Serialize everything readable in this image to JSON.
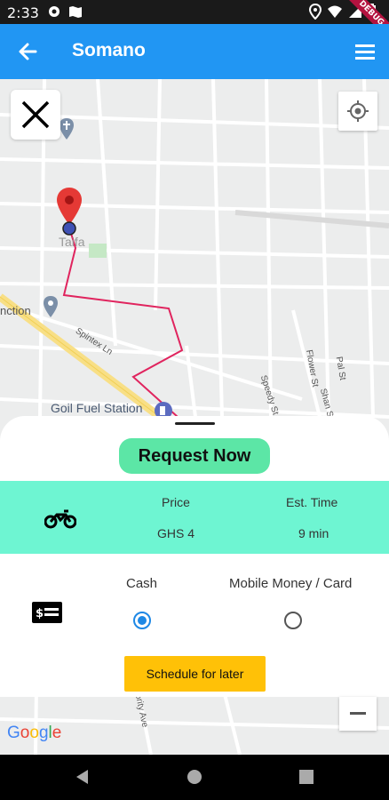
{
  "status_bar": {
    "time": "2:33"
  },
  "debug_banner": "DEBUG",
  "app_bar": {
    "title": "Somano"
  },
  "map": {
    "labels": {
      "taifa": "Taifa",
      "junction": "nction",
      "spintex": "Spintex Ln",
      "goil": "Goil Fuel Station",
      "flower": "Flower St",
      "road2": "Pal St",
      "road3": "Speedy St",
      "road4": "Shan St",
      "road5": "ority Ave"
    },
    "google": "Google"
  },
  "sheet": {
    "request_label": "Request Now",
    "ride_icon": "motorcycle-icon",
    "price_label": "Price",
    "price_value": "GHS 4",
    "time_label": "Est. Time",
    "time_value": "9 min",
    "payment_icon": "money-icon",
    "cash_label": "Cash",
    "mobile_label": "Mobile Money / Card",
    "selected_payment": "Cash",
    "schedule_label": "Schedule for later"
  },
  "colors": {
    "app_bar": "#2196f3",
    "request": "#5ce6a6",
    "ride_band": "#6ef5d2",
    "schedule": "#ffc107",
    "route": "#e0245e"
  }
}
